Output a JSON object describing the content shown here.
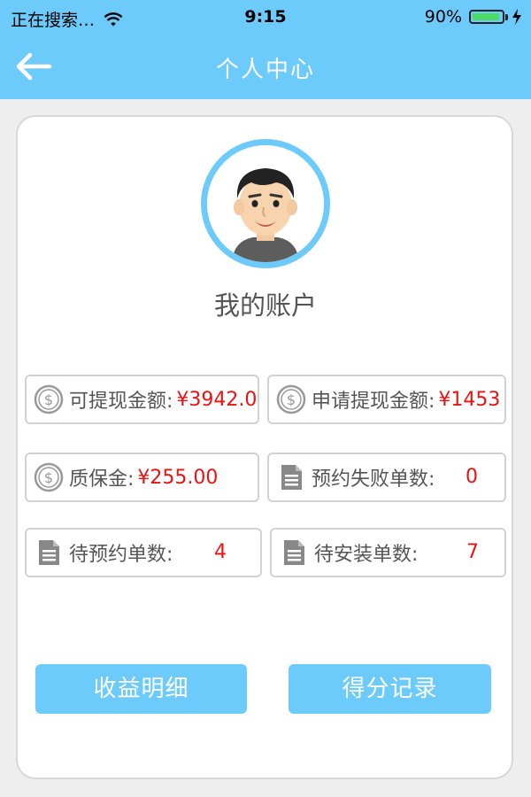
{
  "status_bar": {
    "carrier": "正在搜索…",
    "time": "9:15",
    "battery": "90%"
  },
  "nav": {
    "title": "个人中心",
    "back_icon": "arrow-left-icon"
  },
  "account": {
    "title": "我的账户"
  },
  "stats": {
    "withdrawable": {
      "label": "可提现金额:",
      "value": "¥3942.0"
    },
    "requested": {
      "label": "申请提现金额:",
      "value": "¥1453"
    },
    "deposit": {
      "label": "质保金:",
      "value": "¥255.00"
    },
    "failed_orders": {
      "label": "预约失败单数:",
      "value": "0"
    },
    "pending_reservation": {
      "label": "待预约单数:",
      "value": "4"
    },
    "pending_install": {
      "label": "待安装单数:",
      "value": "7"
    }
  },
  "buttons": {
    "income_detail": "收益明细",
    "score_record": "得分记录"
  },
  "colors": {
    "accent": "#6ccbfb",
    "value_red": "#ee1111",
    "battery_green": "#4cd964"
  }
}
